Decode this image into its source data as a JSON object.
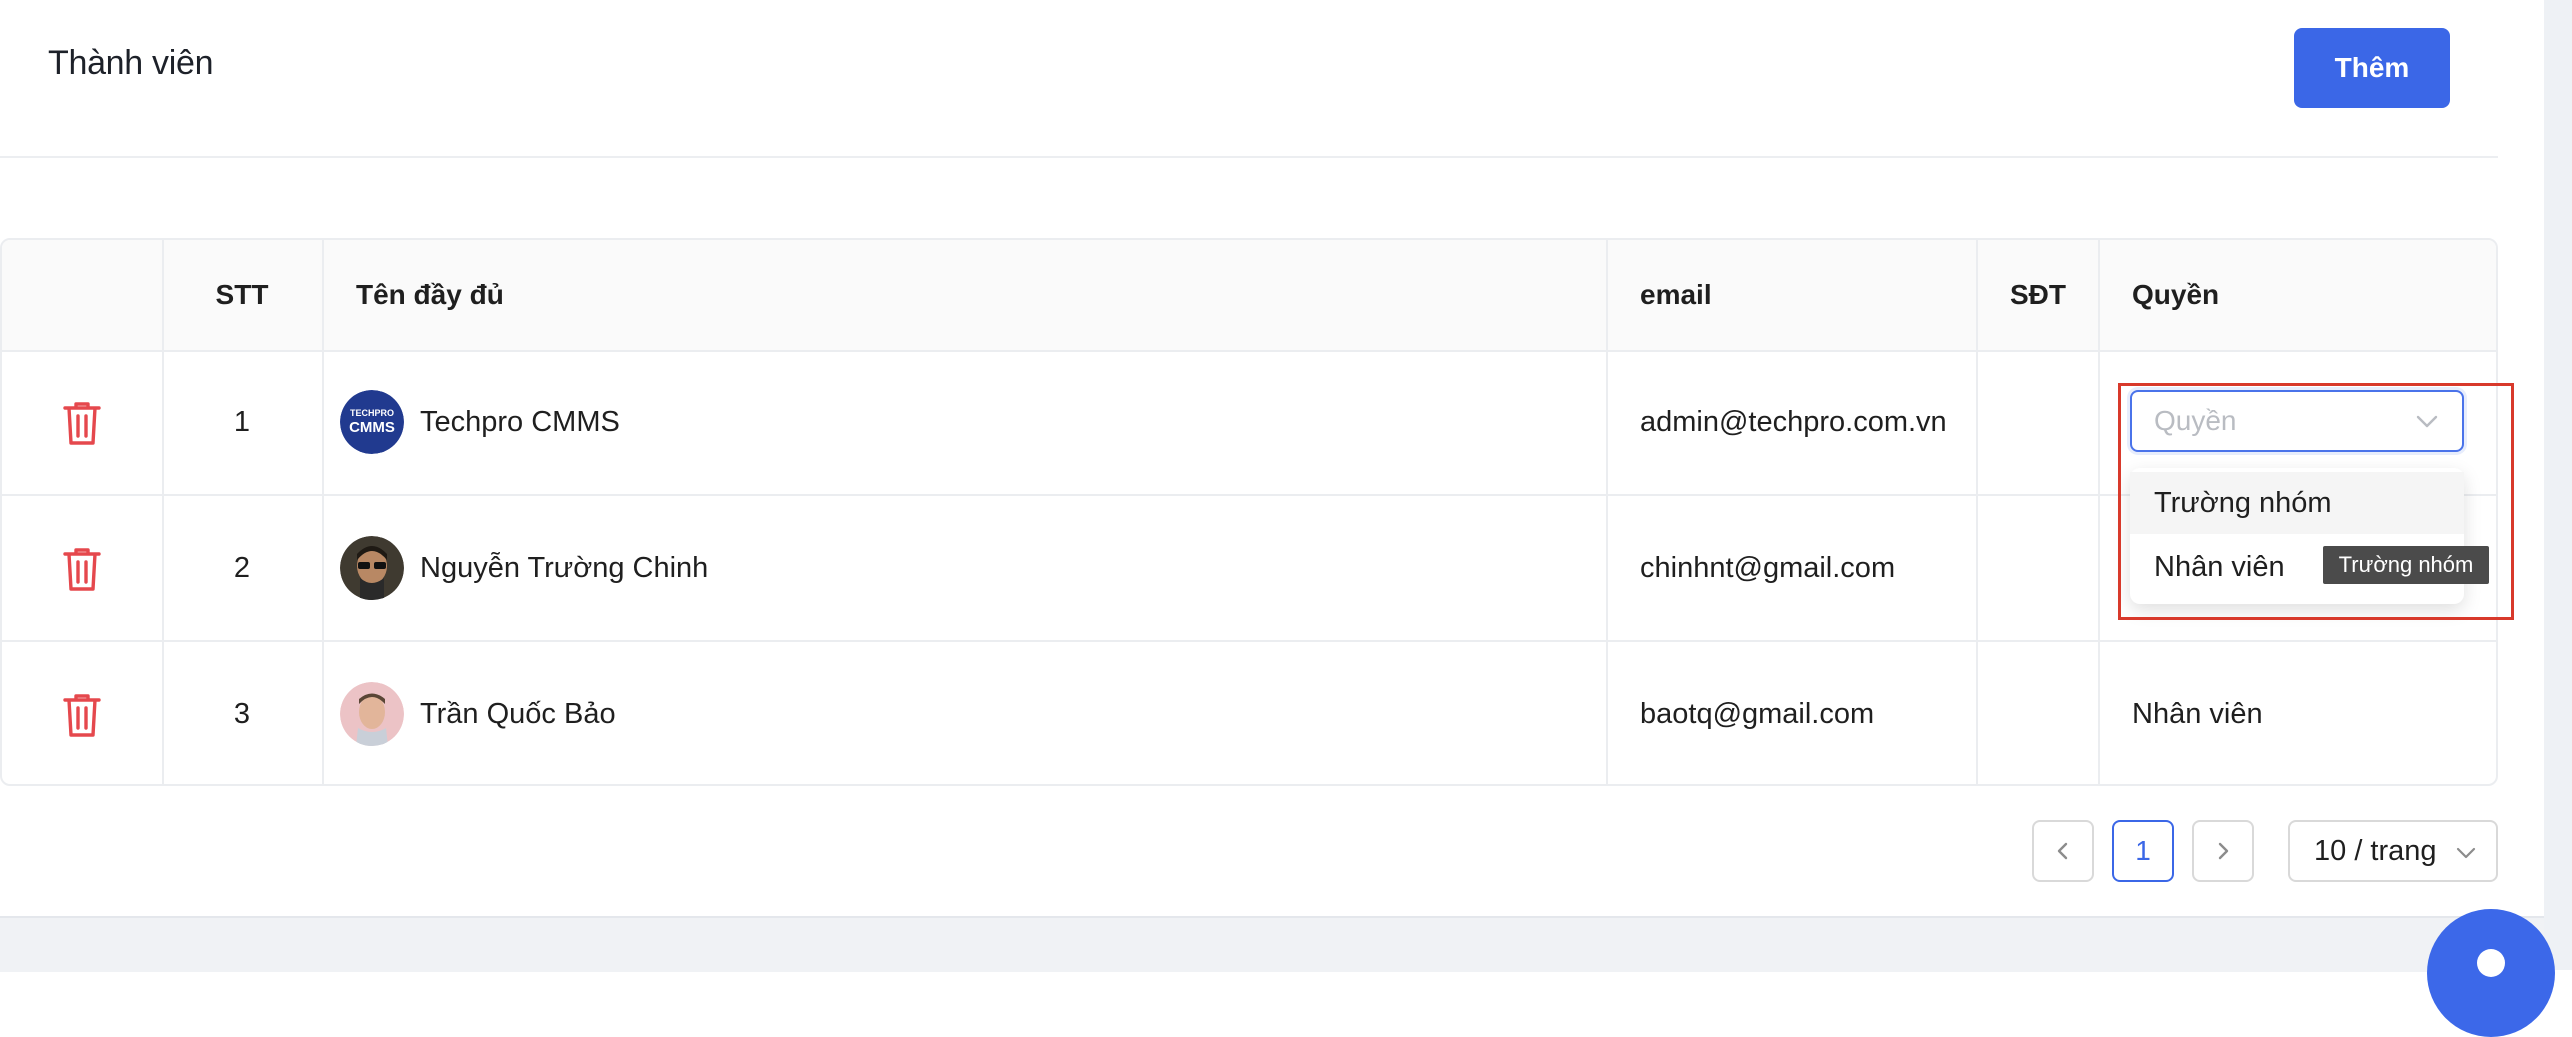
{
  "header": {
    "title": "Thành viên",
    "add_button": "Thêm"
  },
  "table": {
    "columns": [
      "",
      "STT",
      "Tên đầy đủ",
      "email",
      "SĐT",
      "Quyền"
    ],
    "rows": [
      {
        "stt": "1",
        "name": "Techpro CMMS",
        "email": "admin@techpro.com.vn",
        "phone": "",
        "role": "",
        "avatar_text_top": "TECHPRO",
        "avatar_text_main": "CMMS"
      },
      {
        "stt": "2",
        "name": "Nguyễn Trường Chinh",
        "email": "chinhnt@gmail.com",
        "phone": "",
        "role": ""
      },
      {
        "stt": "3",
        "name": "Trần Quốc Bảo",
        "email": "baotq@gmail.com",
        "phone": "",
        "role": "Nhân viên"
      }
    ]
  },
  "role_select": {
    "placeholder": "Quyền",
    "options": [
      "Trường nhóm",
      "Nhân viên"
    ],
    "tooltip": "Trường nhóm"
  },
  "pagination": {
    "current_page": "1",
    "page_size": "10 / trang"
  },
  "colors": {
    "primary": "#3b67e7",
    "danger": "#e5484d",
    "highlight": "#d8392b"
  }
}
